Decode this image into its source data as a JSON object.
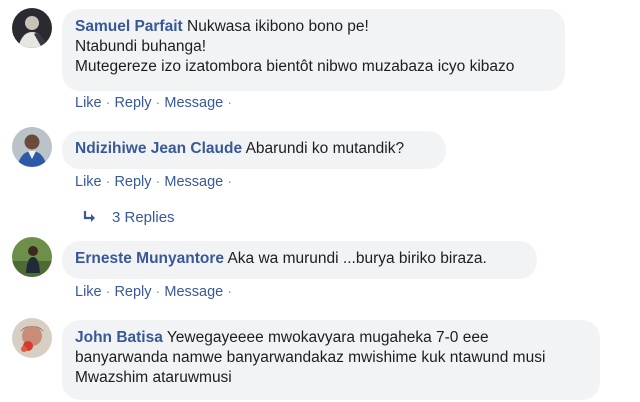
{
  "comments": [
    {
      "author": "Samuel Parfait",
      "lines": [
        "Nukwasa ikibono bono pe!",
        "Ntabundi buhanga!",
        "Mutegereze izo izatombora bientôt nibwo muzabaza icyo kibazo"
      ],
      "actions": {
        "like": "Like",
        "reply": "Reply",
        "message": "Message",
        "sep": "·"
      }
    },
    {
      "author": "Ndizihiwe Jean Claude",
      "lines": [
        "Abarundi ko mutandik?"
      ],
      "actions": {
        "like": "Like",
        "reply": "Reply",
        "message": "Message",
        "sep": "·"
      }
    },
    {
      "author": "Erneste Munyantore",
      "lines": [
        "Aka wa murundi ...burya biriko biraza."
      ],
      "actions": {
        "like": "Like",
        "reply": "Reply",
        "message": "Message",
        "sep": "·"
      }
    },
    {
      "author": "John Batisa",
      "lines": [
        "Yewegayeeee mwokavyara mugaheka 7-0 eee",
        "banyarwanda namwe banyarwandakaz mwishime kuk ntawund musi",
        "Mwazshim ataruwmusi"
      ]
    }
  ],
  "replies": {
    "label": "3 Replies",
    "icon": "reply-arrow-icon"
  },
  "colors": {
    "link": "#385898",
    "bubble": "#f2f3f5",
    "text": "#1c1e21"
  }
}
